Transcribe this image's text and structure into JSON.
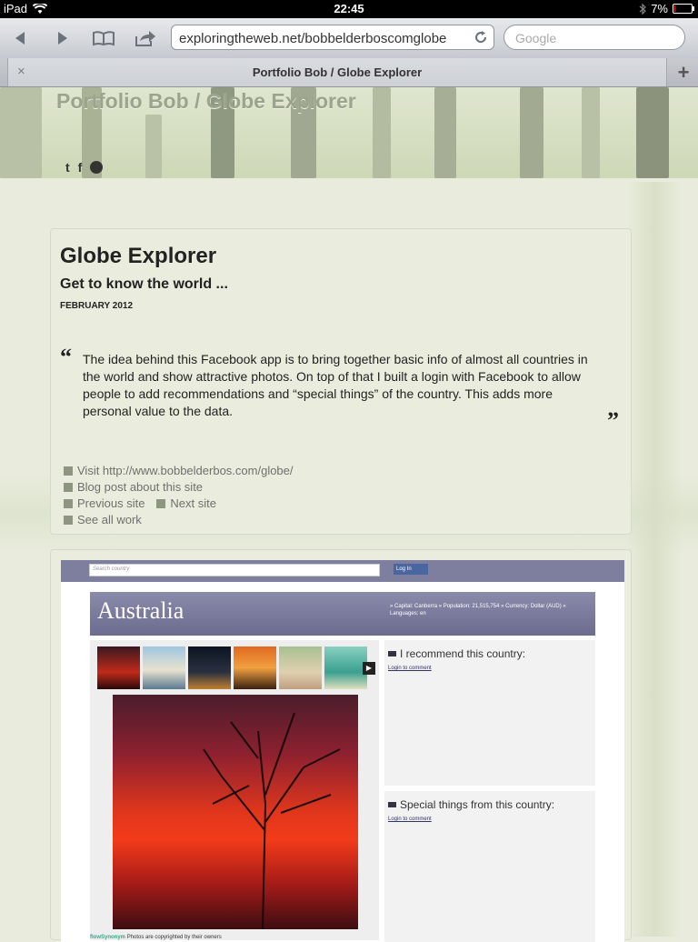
{
  "status_bar": {
    "device": "iPad",
    "time": "22:45",
    "battery": "7%"
  },
  "browser": {
    "url": "exploringtheweb.net/bobbelderboscomglobe",
    "search_placeholder": "Google",
    "tab_title": "Portfolio Bob / Globe Explorer",
    "tab_close": "×",
    "new_tab": "+"
  },
  "site": {
    "title": "Portfolio Bob / Globe Explorer",
    "social": {
      "twitter": "t",
      "facebook": "f",
      "more": "+"
    }
  },
  "project": {
    "title": "Globe Explorer",
    "subtitle": "Get to know the world ...",
    "date": "FEBRUARY 2012",
    "quote_open": "“",
    "quote_close": "”",
    "quote": "The idea behind this Facebook app is to bring together basic info of almost all countries in the world and show attractive photos. On top of that I built a login with Facebook to allow people to add recommendations and “special things” of the country. This adds more personal value to the data.",
    "links": {
      "visit": "Visit http://www.bobbelderbos.com/globe/",
      "blog": "Blog post about this site",
      "previous": "Previous site",
      "next": "Next site",
      "all": "See all work"
    }
  },
  "screenshot": {
    "search_placeholder": "Search country",
    "login": "Log In",
    "country": "Australia",
    "info": "» Capital: Canberra » Population: 21,515,754 » Currency: Dollar (AUD) » Languages: en",
    "recommend_title": "I recommend this country:",
    "special_title": "Special things from this country:",
    "login_link": "Login to comment",
    "copyright_brand": "flowSynonym",
    "copyright": "Photos are copyrighted by their owners"
  },
  "colors": {
    "page_bg": "#e9ecdc",
    "card_bg": "#eaeddd",
    "header_title": "#9ba48c",
    "link_gray": "#6f6f6f",
    "fb_bar": "#7e7e9e"
  }
}
